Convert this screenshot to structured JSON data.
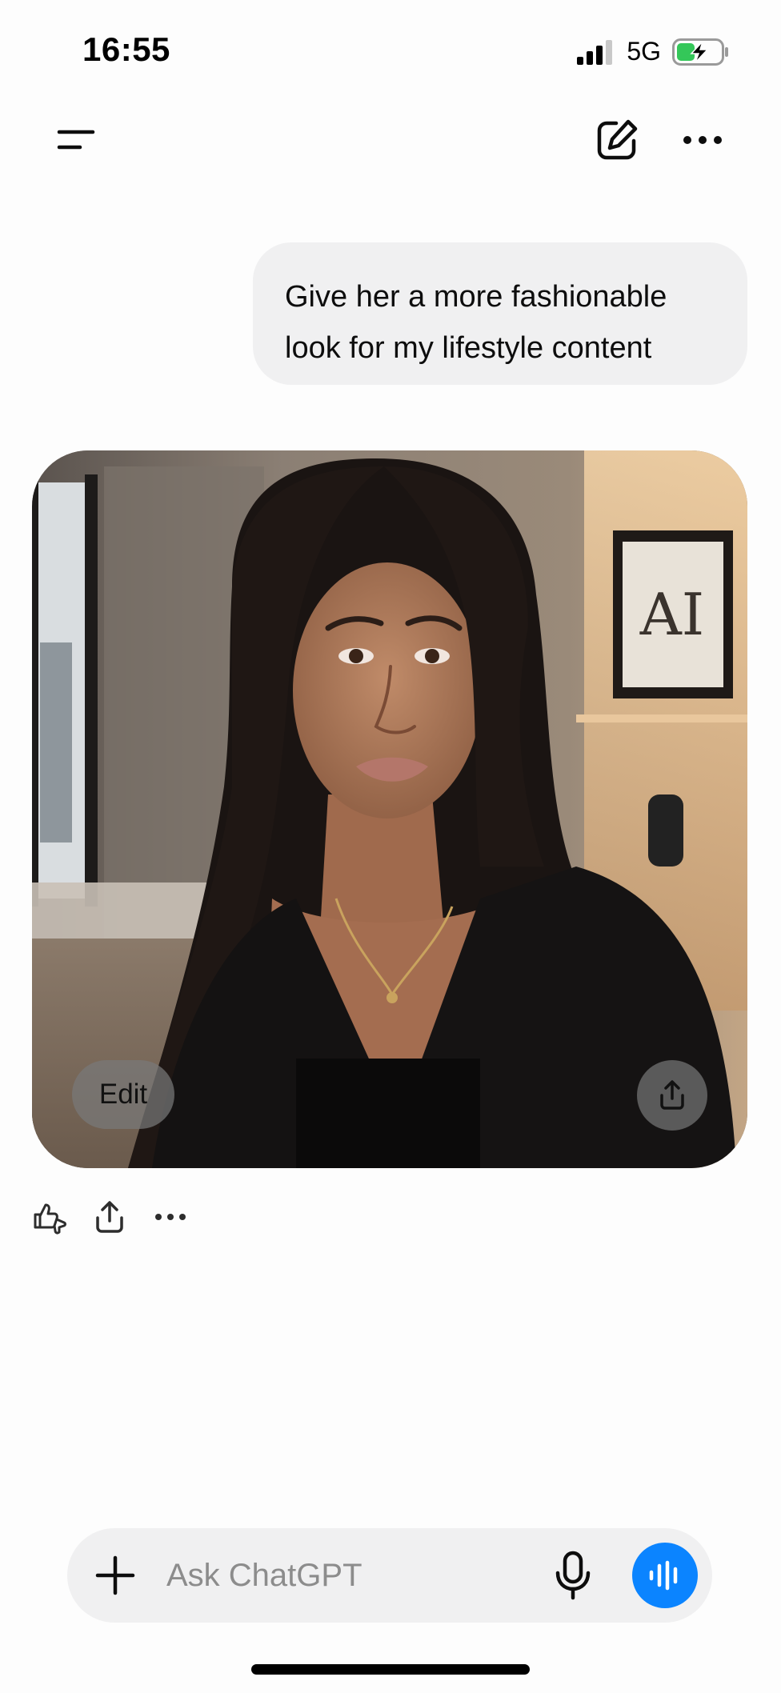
{
  "status_bar": {
    "time": "16:55",
    "network": "5G",
    "signal_icon": "signal-bars-icon",
    "battery_icon": "battery-charging-icon",
    "battery_color": "#34c759"
  },
  "nav": {
    "menu_icon": "menu-icon",
    "compose_icon": "compose-icon",
    "more_icon": "more-icon"
  },
  "conversation": {
    "user_message_line1": "Give her a more fashionable",
    "user_message_line2": "look for my lifestyle content",
    "image": {
      "edit_label": "Edit",
      "share_icon": "share-icon",
      "art_text": "AI"
    },
    "actions": [
      "feedback-icon",
      "share-icon",
      "more-icon"
    ]
  },
  "composer": {
    "placeholder": "Ask ChatGPT",
    "plus_icon": "plus-icon",
    "mic_icon": "microphone-icon",
    "voice_icon": "voice-mode-icon",
    "voice_color": "#0b84ff"
  }
}
